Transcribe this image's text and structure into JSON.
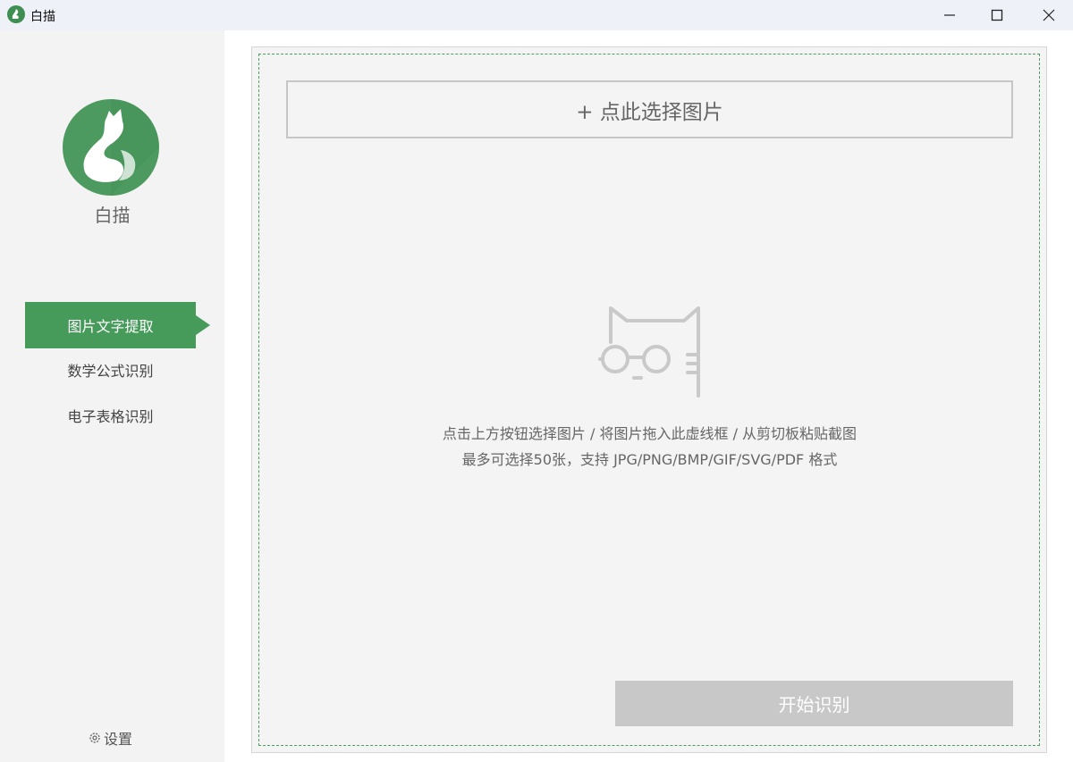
{
  "window": {
    "title": "白描",
    "controls": {
      "minimize": "minimize-icon",
      "maximize": "maximize-icon",
      "close": "close-icon"
    }
  },
  "sidebar": {
    "app_name": "白描",
    "nav": [
      {
        "label": "图片文字提取",
        "active": true
      },
      {
        "label": "数学公式识别",
        "active": false
      },
      {
        "label": "电子表格识别",
        "active": false
      }
    ],
    "settings_label": "设置"
  },
  "main": {
    "select_button": "+ 点此选择图片",
    "hint_line1": "点击上方按钮选择图片 / 将图片拖入此虚线框 / 从剪切板粘贴截图",
    "hint_line2": "最多可选择50张，支持 JPG/PNG/BMP/GIF/SVG/PDF 格式",
    "start_button": "开始识别"
  },
  "colors": {
    "accent": "#469a5a",
    "dashed_border": "#4aa05f",
    "disabled_button": "#c8c8c8",
    "panel_bg": "#f4f4f4"
  }
}
